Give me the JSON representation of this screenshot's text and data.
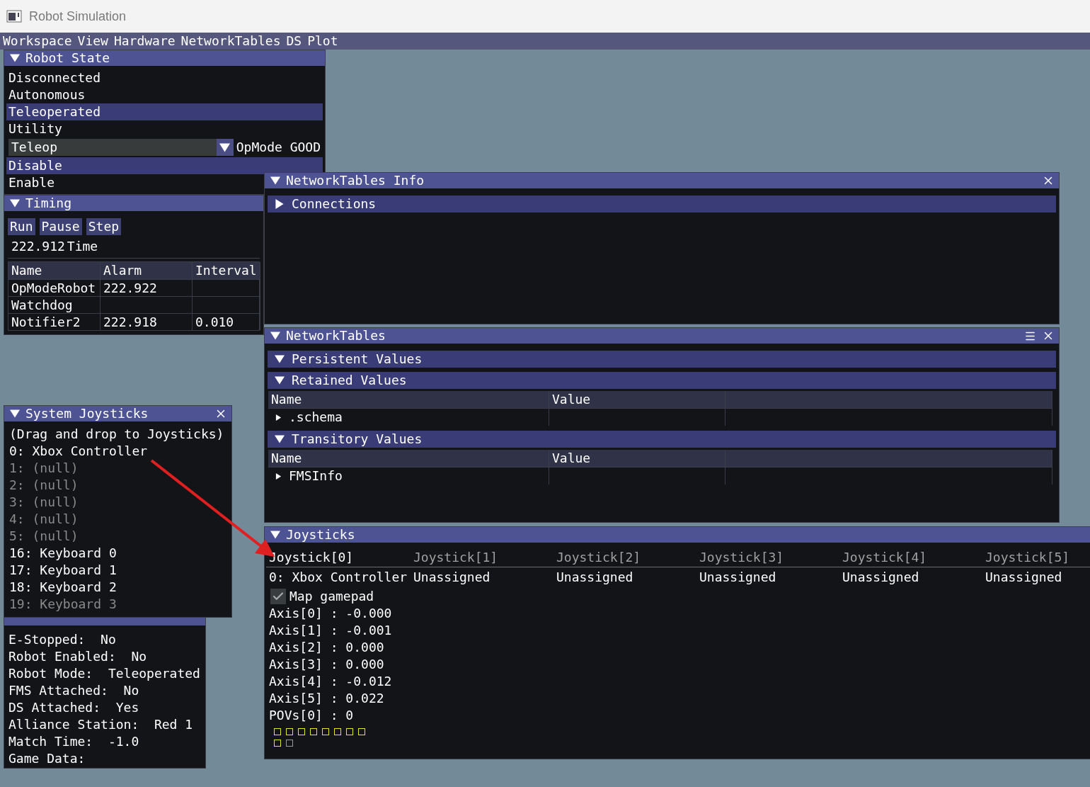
{
  "app": {
    "title": "Robot Simulation"
  },
  "menu": [
    "Workspace",
    "View",
    "Hardware",
    "NetworkTables",
    "DS",
    "Plot"
  ],
  "robot_state": {
    "title": "Robot State",
    "expanded": true,
    "modes": [
      {
        "label": "Disconnected",
        "selected": false
      },
      {
        "label": "Autonomous",
        "selected": false
      },
      {
        "label": "Teleoperated",
        "selected": true
      },
      {
        "label": "Utility",
        "selected": false
      }
    ],
    "opmode": {
      "value": "Teleop",
      "status": "OpMode GOOD"
    },
    "enable": [
      {
        "label": "Disable",
        "selected": true
      },
      {
        "label": "Enable",
        "selected": false
      }
    ]
  },
  "timing": {
    "title": "Timing",
    "expanded": true,
    "buttons": [
      "Run",
      "Pause",
      "Step"
    ],
    "time_value": "222.912",
    "time_label": "Time",
    "columns": [
      "Name",
      "Alarm",
      "Interval"
    ],
    "rows": [
      {
        "name": "OpModeRobot",
        "alarm": "222.922"
      },
      {
        "name": "Watchdog"
      },
      {
        "name": "Notifier2",
        "alarm": "222.918",
        "interval": "0.010"
      }
    ]
  },
  "nt_info": {
    "title": "NetworkTables Info",
    "expanded": true,
    "sections": [
      {
        "label": "Connections",
        "expanded": false
      }
    ]
  },
  "networktables": {
    "title": "NetworkTables",
    "expanded": true,
    "sections": [
      {
        "label": "Persistent Values",
        "expanded": true
      },
      {
        "label": "Retained Values",
        "expanded": true,
        "columns": [
          "Name",
          "Value"
        ],
        "rows": [
          {
            "name": ".schema",
            "expanded": false
          }
        ]
      },
      {
        "label": "Transitory Values",
        "expanded": true,
        "columns": [
          "Name",
          "Value"
        ],
        "rows": [
          {
            "name": "FMSInfo",
            "expanded": false
          }
        ]
      }
    ]
  },
  "system_joysticks": {
    "title": "System Joysticks",
    "expanded": true,
    "hint": "(Drag and drop to Joysticks)",
    "items": [
      {
        "label": "0: Xbox Controller",
        "disabled": false
      },
      {
        "label": "1: (null)",
        "disabled": true
      },
      {
        "label": "2: (null)",
        "disabled": true
      },
      {
        "label": "3: (null)",
        "disabled": true
      },
      {
        "label": "4: (null)",
        "disabled": true
      },
      {
        "label": "5: (null)",
        "disabled": true
      },
      {
        "label": "16: Keyboard 0",
        "disabled": false
      },
      {
        "label": "17: Keyboard 1",
        "disabled": false
      },
      {
        "label": "18: Keyboard 2",
        "disabled": false
      },
      {
        "label": "19: Keyboard 3",
        "disabled": true
      }
    ]
  },
  "fms": {
    "lines": [
      "E-Stopped:  No",
      "Robot Enabled:  No",
      "Robot Mode:  Teleoperated",
      "FMS Attached:  No",
      "DS Attached:  Yes",
      "Alliance Station:  Red 1",
      "Match Time:  -1.0",
      "Game Data:"
    ]
  },
  "joysticks": {
    "title": "Joysticks",
    "expanded": true,
    "slots": [
      {
        "tab": "Joystick[0]",
        "selected": true,
        "device": "0: Xbox Controller"
      },
      {
        "tab": "Joystick[1]",
        "selected": false,
        "device": "Unassigned"
      },
      {
        "tab": "Joystick[2]",
        "selected": false,
        "device": "Unassigned"
      },
      {
        "tab": "Joystick[3]",
        "selected": false,
        "device": "Unassigned"
      },
      {
        "tab": "Joystick[4]",
        "selected": false,
        "device": "Unassigned"
      },
      {
        "tab": "Joystick[5]",
        "selected": false,
        "device": "Unassigned"
      }
    ],
    "map_gamepad": {
      "label": "Map gamepad",
      "checked": true
    },
    "readings": [
      "Axis[0] : -0.000",
      "Axis[1] : -0.001",
      "Axis[2] : 0.000",
      "Axis[3] : 0.000",
      "Axis[4] : -0.012",
      "Axis[5] : 0.022",
      "POVs[0] : 0"
    ],
    "buttons": [
      {
        "color": "#e6e61e"
      },
      {
        "color": "#e6e61e"
      },
      {
        "color": "#e6e61e"
      },
      {
        "color": "#e6e61e"
      },
      {
        "color": "#e6e61e"
      },
      {
        "color": "#e6e61e"
      },
      {
        "color": "#e6e61e"
      },
      {
        "color": "#e6e61e"
      },
      {
        "color": "#e6e61e"
      },
      {
        "color": "#9a9a9a"
      }
    ]
  }
}
